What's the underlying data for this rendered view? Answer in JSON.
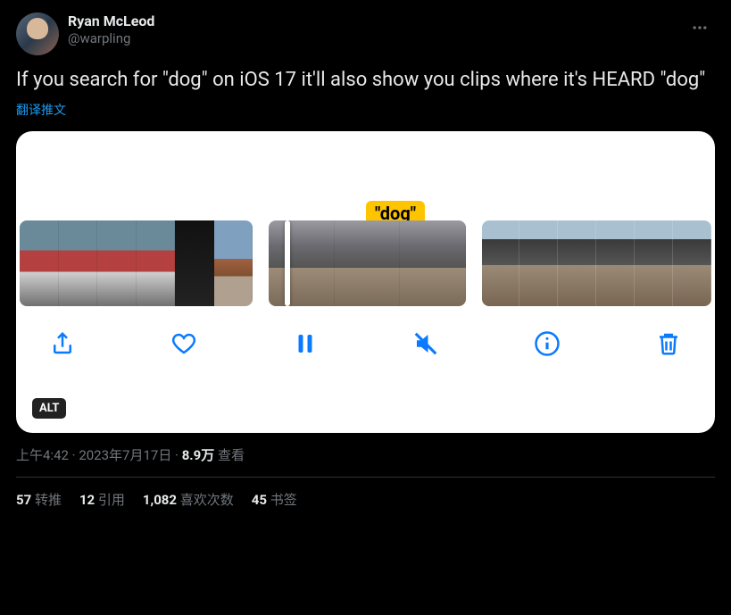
{
  "author": {
    "display_name": "Ryan McLeod",
    "handle": "@warpling"
  },
  "tweet_text": "If you search for \"dog\" on iOS 17 it'll also show you clips where it's HEARD \"dog\"",
  "translate_label": "翻译推文",
  "media": {
    "caption_bubble": "\"dog\"",
    "alt_badge": "ALT"
  },
  "meta": {
    "time": "上午4:42",
    "sep": " · ",
    "date": "2023年7月17日",
    "views_count": "8.9万",
    "views_label": " 查看"
  },
  "stats": {
    "retweets_count": "57",
    "retweets_label": " 转推",
    "quotes_count": "12",
    "quotes_label": " 引用",
    "likes_count": "1,082",
    "likes_label": " 喜欢次数",
    "bookmarks_count": "45",
    "bookmarks_label": " 书签"
  }
}
